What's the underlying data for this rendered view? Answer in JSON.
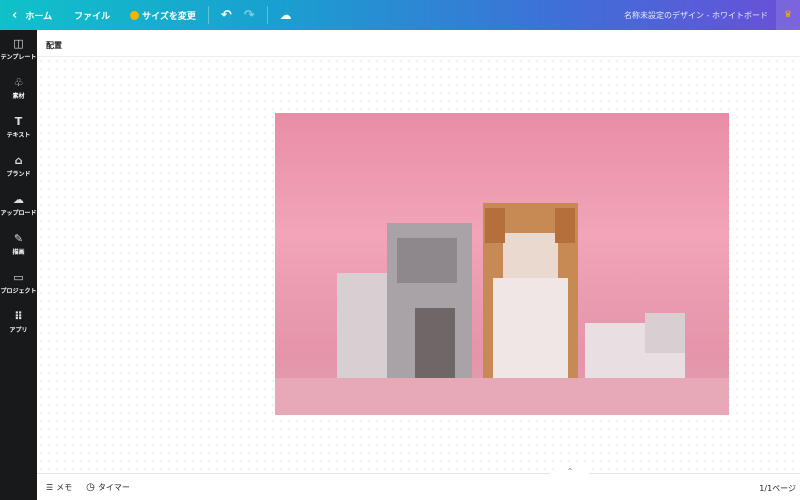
{
  "topbar": {
    "back": "‹",
    "home": "ホーム",
    "file": "ファイル",
    "resize": "サイズを変更",
    "undo": "↶",
    "redo": "↷",
    "cloud": "☁",
    "title": "名称未設定のデザイン - ホワイトボード",
    "crown": "♛"
  },
  "sidebar": {
    "items": [
      {
        "icon": "◫",
        "label": "テンプレート",
        "name": "template"
      },
      {
        "icon": "♧",
        "label": "素材",
        "name": "elements"
      },
      {
        "icon": "T",
        "label": "テキスト",
        "name": "text"
      },
      {
        "icon": "⌂",
        "label": "ブランド",
        "name": "brand"
      },
      {
        "icon": "☁",
        "label": "アップロード",
        "name": "upload"
      },
      {
        "icon": "✎",
        "label": "描画",
        "name": "draw"
      },
      {
        "icon": "▭",
        "label": "プロジェクト",
        "name": "projects"
      },
      {
        "icon": "⠿",
        "label": "アプリ",
        "name": "apps"
      }
    ]
  },
  "subbar": {
    "label": "配置"
  },
  "bottom": {
    "memo_icon": "☰",
    "memo": "メモ",
    "timer_icon": "◷",
    "timer": "タイマー",
    "expand": "^",
    "pages": "1/1ページ"
  },
  "colors": {
    "accent_start": "#10c1c9",
    "accent_end": "#6a4fd8",
    "sidebar": "#18191b"
  }
}
